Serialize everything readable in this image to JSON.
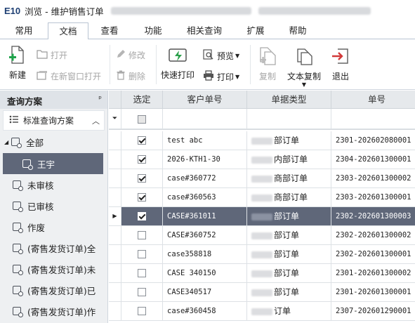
{
  "window": {
    "app_logo": "E10",
    "title": "浏览 - 维护销售订单"
  },
  "menu_tabs": [
    "常用",
    "文档",
    "查看",
    "功能",
    "相关查询",
    "扩展",
    "帮助"
  ],
  "active_tab": "文档",
  "ribbon": {
    "new": "新建",
    "open": "打开",
    "open_new_window": "在新窗口打开",
    "modify": "修改",
    "delete": "删除",
    "quick_print": "快速打印",
    "preview": "预览",
    "print": "打印",
    "copy": "复制",
    "text_copy": "文本复制",
    "exit": "退出"
  },
  "left_panel": {
    "header": "查询方案",
    "pin": "ᵖ",
    "standard_scheme": "标准查询方案",
    "tree": [
      "全部",
      "王宇",
      "未审核",
      "已审核",
      "作废",
      "(寄售发货订单)全",
      "(寄售发货订单)未",
      "(寄售发货订单)已",
      "(寄售发货订单)作"
    ]
  },
  "grid": {
    "columns": [
      "选定",
      "客户单号",
      "单据类型",
      "单号"
    ],
    "rows": [
      {
        "checked": true,
        "customer_no": "test abc",
        "doc_type": "部订单",
        "doc_no": "2301-202602080001"
      },
      {
        "checked": true,
        "customer_no": "2026-KTH1-30",
        "doc_type": "内部订单",
        "doc_no": "2304-202601300001"
      },
      {
        "checked": true,
        "customer_no": "case#360772",
        "doc_type": "商部订单",
        "doc_no": "2303-202601300002"
      },
      {
        "checked": true,
        "customer_no": "case#360563",
        "doc_type": "商部订单",
        "doc_no": "2303-202601300001"
      },
      {
        "checked": true,
        "customer_no": "CASE#361011",
        "doc_type": "部订单",
        "doc_no": "2302-202601300003",
        "selected": true
      },
      {
        "checked": false,
        "customer_no": "CASE#360752",
        "doc_type": "部订单",
        "doc_no": "2302-202601300002"
      },
      {
        "checked": false,
        "customer_no": "case358818",
        "doc_type": "部订单",
        "doc_no": "2302-202601300001"
      },
      {
        "checked": false,
        "customer_no": "CASE 340150",
        "doc_type": "部订单",
        "doc_no": "2301-202601300002"
      },
      {
        "checked": false,
        "customer_no": "CASE340517",
        "doc_type": "部订单",
        "doc_no": "2301-202601300001"
      },
      {
        "checked": false,
        "customer_no": "case#360458",
        "doc_type": "订单",
        "doc_no": "2307-202601290001"
      }
    ]
  }
}
